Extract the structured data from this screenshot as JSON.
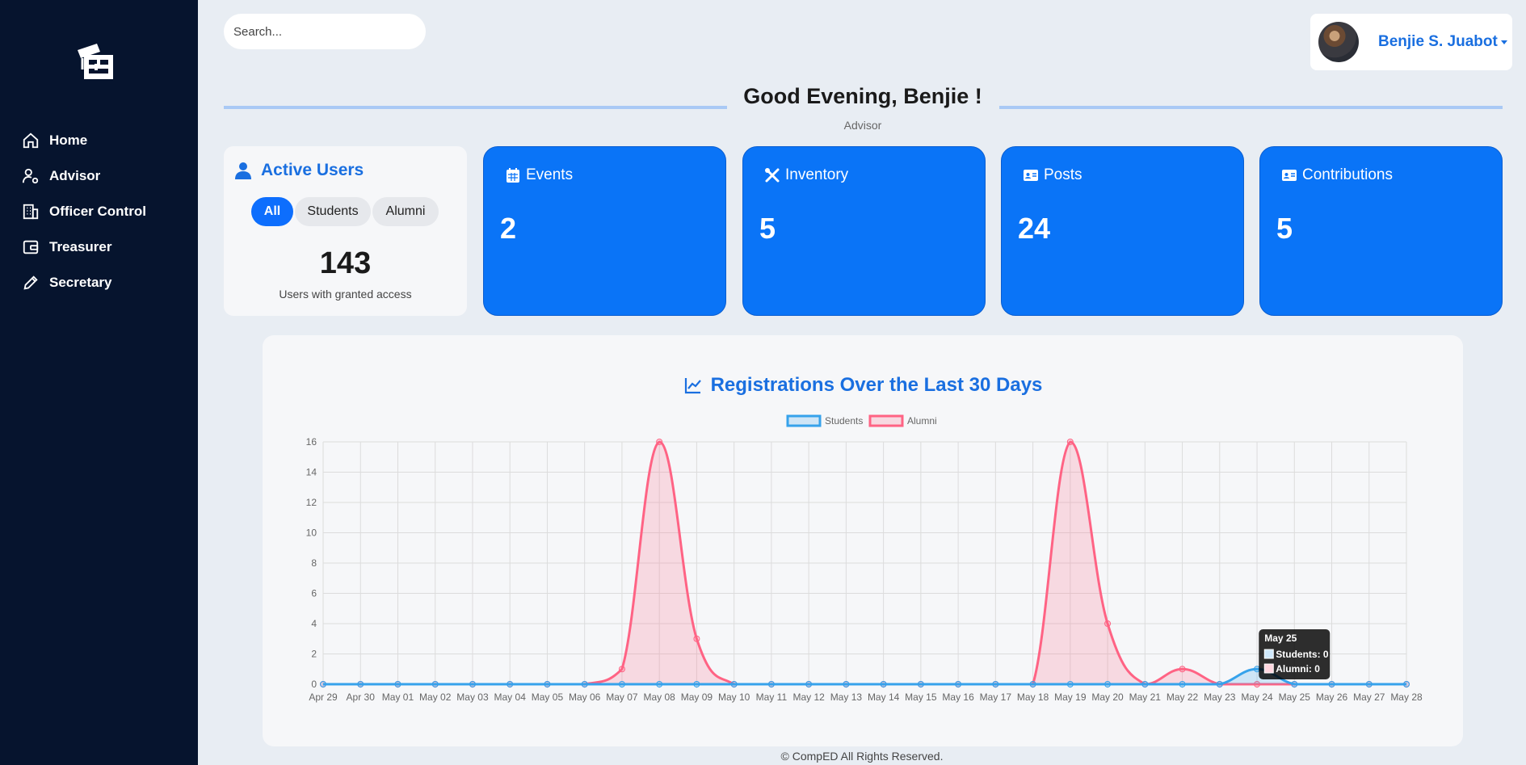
{
  "sidebar": {
    "logo": "comped-logo",
    "items": [
      {
        "label": "Home",
        "icon": "home-icon"
      },
      {
        "label": "Advisor",
        "icon": "user-cog-icon"
      },
      {
        "label": "Officer Control",
        "icon": "building-icon"
      },
      {
        "label": "Treasurer",
        "icon": "wallet-icon"
      },
      {
        "label": "Secretary",
        "icon": "pencil-icon"
      }
    ]
  },
  "header": {
    "search_placeholder": "Search...",
    "user_name": "Benjie S. Juabot"
  },
  "greeting": {
    "title": "Good Evening, Benjie !",
    "role": "Advisor"
  },
  "active_users": {
    "title": "Active Users",
    "filters": [
      "All",
      "Students",
      "Alumni"
    ],
    "selected_filter": "All",
    "count": "143",
    "caption": "Users with granted access"
  },
  "stats": [
    {
      "title": "Events",
      "value": "2",
      "icon": "calendar-icon"
    },
    {
      "title": "Inventory",
      "value": "5",
      "icon": "tools-icon"
    },
    {
      "title": "Posts",
      "value": "24",
      "icon": "id-card-icon"
    },
    {
      "title": "Contributions",
      "value": "5",
      "icon": "id-card-icon"
    }
  ],
  "colors": {
    "sidebar_bg": "#06142e",
    "accent": "#0a74f7",
    "students": "#36a2eb",
    "alumni": "#ff6384"
  },
  "chart_data": {
    "type": "line",
    "title": "Registrations Over the Last 30 Days",
    "x": [
      "Apr 29",
      "Apr 30",
      "May 01",
      "May 02",
      "May 03",
      "May 04",
      "May 05",
      "May 06",
      "May 07",
      "May 08",
      "May 09",
      "May 10",
      "May 11",
      "May 12",
      "May 13",
      "May 14",
      "May 15",
      "May 16",
      "May 17",
      "May 18",
      "May 19",
      "May 20",
      "May 21",
      "May 22",
      "May 23",
      "May 24",
      "May 25",
      "May 26",
      "May 27",
      "May 28"
    ],
    "ylim": [
      0,
      16
    ],
    "yticks": [
      0,
      2,
      4,
      6,
      8,
      10,
      12,
      14,
      16
    ],
    "grid": true,
    "legend": "top",
    "series": [
      {
        "name": "Students",
        "values": [
          0,
          0,
          0,
          0,
          0,
          0,
          0,
          0,
          0,
          0,
          0,
          0,
          0,
          0,
          0,
          0,
          0,
          0,
          0,
          0,
          0,
          0,
          0,
          0,
          0,
          1,
          0,
          0,
          0,
          0
        ]
      },
      {
        "name": "Alumni",
        "values": [
          0,
          0,
          0,
          0,
          0,
          0,
          0,
          0,
          1,
          16,
          3,
          0,
          0,
          0,
          0,
          0,
          0,
          0,
          0,
          0,
          16,
          4,
          0,
          1,
          0,
          0,
          0,
          0,
          0,
          0
        ]
      }
    ],
    "tooltip": {
      "title": "May 25",
      "lines": [
        "Students: 0",
        "Alumni: 0"
      ]
    }
  },
  "footer": "© CompED All Rights Reserved."
}
